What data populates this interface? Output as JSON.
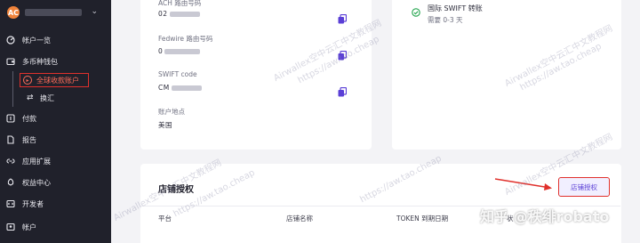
{
  "sidebar": {
    "account_initial": "AC",
    "chevron": "⌄",
    "items": [
      {
        "label": "帐户一览",
        "icon": "gauge-icon"
      },
      {
        "label": "多币种钱包",
        "icon": "wallet-icon"
      },
      {
        "label": "付款",
        "icon": "payment-icon"
      },
      {
        "label": "报告",
        "icon": "report-icon"
      },
      {
        "label": "应用扩展",
        "icon": "extension-icon"
      },
      {
        "label": "权益中心",
        "icon": "rocket-icon"
      },
      {
        "label": "开发者",
        "icon": "code-icon"
      },
      {
        "label": "帐户",
        "icon": "account-icon"
      }
    ],
    "subitems": [
      {
        "label": "全球收款账户",
        "active": true
      },
      {
        "label": "换汇",
        "active": false
      }
    ]
  },
  "bank_details": {
    "ach": {
      "label": "ACH 路由号码",
      "value_prefix": "02"
    },
    "fedwire": {
      "label": "Fedwire 路由号码",
      "value_prefix": "0"
    },
    "swift": {
      "label": "SWIFT code",
      "value_prefix": "CM"
    },
    "location": {
      "label": "账户地点",
      "value": "美国"
    }
  },
  "swift_transfer": {
    "title": "国际 SWIFT 转账",
    "subtitle": "需要 0-3 天"
  },
  "shop": {
    "title": "店铺授权",
    "auth_button": "店铺授权",
    "columns": [
      "平台",
      "店铺名称",
      "TOKEN 到期日期",
      "状"
    ]
  },
  "watermark": {
    "text1": "Airwallex空中云汇中文教程网",
    "text2": "https://aw.tao.cheap",
    "zhihu": "知乎 @秩绯robato"
  },
  "colors": {
    "sidebar_bg": "#20212b",
    "accent": "#5a3fd6",
    "highlight": "#e0312c",
    "success": "#1fa34a"
  }
}
